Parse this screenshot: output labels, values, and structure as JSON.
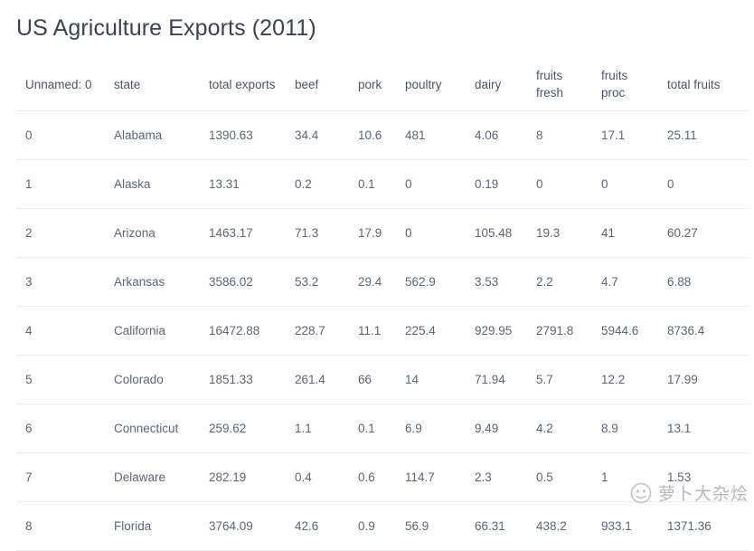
{
  "page": {
    "title": "US Agriculture Exports (2011)"
  },
  "table": {
    "columns": [
      {
        "key": "index",
        "label": "Unnamed: 0"
      },
      {
        "key": "state",
        "label": "state"
      },
      {
        "key": "total",
        "label": "total exports"
      },
      {
        "key": "beef",
        "label": "beef"
      },
      {
        "key": "pork",
        "label": "pork"
      },
      {
        "key": "poultry",
        "label": "poultry"
      },
      {
        "key": "dairy",
        "label": "dairy"
      },
      {
        "key": "ffresh",
        "label": "fruits fresh"
      },
      {
        "key": "fproc",
        "label": "fruits proc"
      },
      {
        "key": "tfruits",
        "label": "total fruits"
      }
    ],
    "rows": [
      {
        "index": "0",
        "state": "Alabama",
        "total": "1390.63",
        "beef": "34.4",
        "pork": "10.6",
        "poultry": "481",
        "dairy": "4.06",
        "ffresh": "8",
        "fproc": "17.1",
        "tfruits": "25.11"
      },
      {
        "index": "1",
        "state": "Alaska",
        "total": "13.31",
        "beef": "0.2",
        "pork": "0.1",
        "poultry": "0",
        "dairy": "0.19",
        "ffresh": "0",
        "fproc": "0",
        "tfruits": "0"
      },
      {
        "index": "2",
        "state": "Arizona",
        "total": "1463.17",
        "beef": "71.3",
        "pork": "17.9",
        "poultry": "0",
        "dairy": "105.48",
        "ffresh": "19.3",
        "fproc": "41",
        "tfruits": "60.27"
      },
      {
        "index": "3",
        "state": "Arkansas",
        "total": "3586.02",
        "beef": "53.2",
        "pork": "29.4",
        "poultry": "562.9",
        "dairy": "3.53",
        "ffresh": "2.2",
        "fproc": "4.7",
        "tfruits": "6.88"
      },
      {
        "index": "4",
        "state": "California",
        "total": "16472.88",
        "beef": "228.7",
        "pork": "11.1",
        "poultry": "225.4",
        "dairy": "929.95",
        "ffresh": "2791.8",
        "fproc": "5944.6",
        "tfruits": "8736.4"
      },
      {
        "index": "5",
        "state": "Colorado",
        "total": "1851.33",
        "beef": "261.4",
        "pork": "66",
        "poultry": "14",
        "dairy": "71.94",
        "ffresh": "5.7",
        "fproc": "12.2",
        "tfruits": "17.99"
      },
      {
        "index": "6",
        "state": "Connecticut",
        "total": "259.62",
        "beef": "1.1",
        "pork": "0.1",
        "poultry": "6.9",
        "dairy": "9.49",
        "ffresh": "4.2",
        "fproc": "8.9",
        "tfruits": "13.1"
      },
      {
        "index": "7",
        "state": "Delaware",
        "total": "282.19",
        "beef": "0.4",
        "pork": "0.6",
        "poultry": "114.7",
        "dairy": "2.3",
        "ffresh": "0.5",
        "fproc": "1",
        "tfruits": "1.53"
      },
      {
        "index": "8",
        "state": "Florida",
        "total": "3764.09",
        "beef": "42.6",
        "pork": "0.9",
        "poultry": "56.9",
        "dairy": "66.31",
        "ffresh": "438.2",
        "fproc": "933.1",
        "tfruits": "1371.36"
      }
    ]
  },
  "watermark": {
    "text": "萝卜大杂烩",
    "logo": "circle-logo-icon"
  },
  "colors": {
    "title": "#3b4252",
    "header_text": "#4b5566",
    "cell_text": "#5c6675",
    "divider": "#ededf0",
    "header_divider": "#e6e8eb",
    "background": "#ffffff"
  }
}
